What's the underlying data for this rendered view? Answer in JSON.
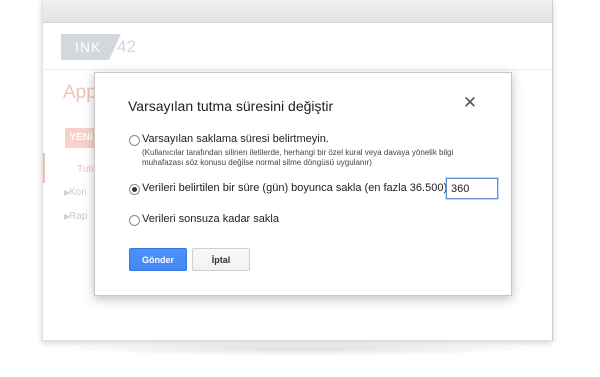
{
  "app": {
    "logo_text": "INK",
    "logo_number": "42",
    "page_title_partial": "Apps",
    "new_button_partial": "YENİ",
    "nav": [
      {
        "label": "Tutm",
        "active": true
      },
      {
        "label": "Kon",
        "active": false
      },
      {
        "label": "Rap",
        "active": false
      }
    ]
  },
  "dialog": {
    "title": "Varsayılan tutma süresini değiştir",
    "close_glyph": "✕",
    "options": [
      {
        "label": "Varsayılan saklama süresi belirtmeyin.",
        "note": "(Kullanıcılar tarafından silinen iletilerde, herhangi bir özel kural veya davaya yönelik bilgi muhafazası söz konusu değilse normal silme döngüsü uygulanır)",
        "checked": false
      },
      {
        "label": "Verileri belirtilen bir süre (gün) boyunca sakla (en fazla 36.500):",
        "checked": true
      },
      {
        "label": "Verileri sonsuza kadar sakla",
        "checked": false
      }
    ],
    "days_value": "360",
    "submit_label": "Gönder",
    "cancel_label": "İptal"
  }
}
